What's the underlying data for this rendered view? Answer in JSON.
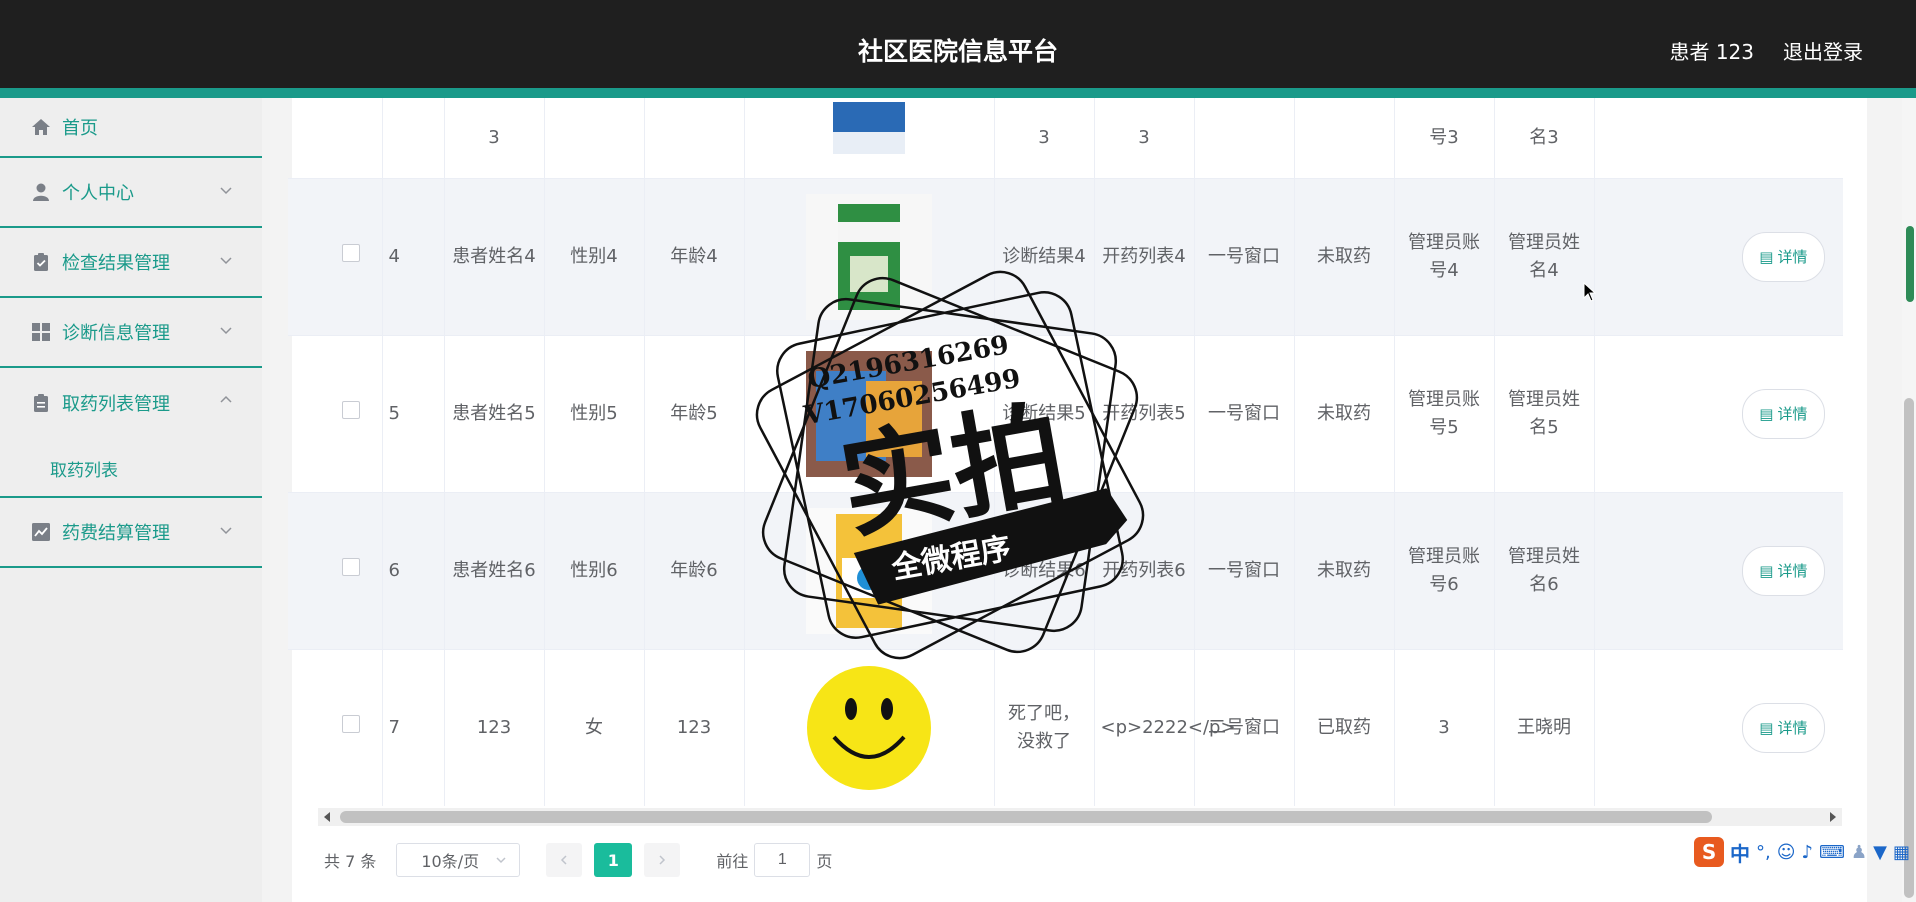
{
  "header": {
    "title": "社区医院信息平台",
    "user": "患者 123",
    "logout": "退出登录"
  },
  "sidebar": {
    "items": [
      {
        "label": "首页",
        "icon": "home-icon"
      },
      {
        "label": "个人中心",
        "icon": "person-icon"
      },
      {
        "label": "检查结果管理",
        "icon": "clipboard-check-icon"
      },
      {
        "label": "诊断信息管理",
        "icon": "grid-icon"
      },
      {
        "label": "取药列表管理",
        "icon": "clipboard-icon"
      },
      {
        "label": "药费结算管理",
        "icon": "chart-icon"
      }
    ],
    "submenu": {
      "label": "取药列表"
    }
  },
  "table": {
    "detail_label": "详情",
    "top_row": {
      "c3": "3",
      "c7": "3",
      "c8": "3",
      "c11": "号3",
      "c12": "名3"
    },
    "rows": [
      {
        "id": "4",
        "name": "患者姓名4",
        "gender": "性别4",
        "age": "年龄4",
        "diag": "诊断结果4",
        "rx": "开药列表4",
        "window": "一号窗口",
        "status": "未取药",
        "acct": "管理员账号4",
        "admin": "管理员姓名4"
      },
      {
        "id": "5",
        "name": "患者姓名5",
        "gender": "性别5",
        "age": "年龄5",
        "diag": "诊断结果5",
        "rx": "开药列表5",
        "window": "一号窗口",
        "status": "未取药",
        "acct": "管理员账号5",
        "admin": "管理员姓名5"
      },
      {
        "id": "6",
        "name": "患者姓名6",
        "gender": "性别6",
        "age": "年龄6",
        "diag": "诊断结果6",
        "rx": "开药列表6",
        "window": "一号窗口",
        "status": "未取药",
        "acct": "管理员账号6",
        "admin": "管理员姓名6"
      },
      {
        "id": "7",
        "name": "123",
        "gender": "女",
        "age": "123",
        "diag": "死了吧，没救了",
        "rx": "<p>2222</p>",
        "window": "二号窗口",
        "status": "已取药",
        "acct": "3",
        "admin": "王晓明"
      }
    ]
  },
  "pager": {
    "total": "共 7 条",
    "size": "10条/页",
    "page": "1",
    "goto": "前往",
    "goto_value": "1",
    "page_unit": "页"
  },
  "watermark": {
    "line1": "Q2196316269",
    "line2": "V17060256499",
    "big": "实拍",
    "ribbon": "全微程序"
  },
  "ime": {
    "label": "中"
  }
}
